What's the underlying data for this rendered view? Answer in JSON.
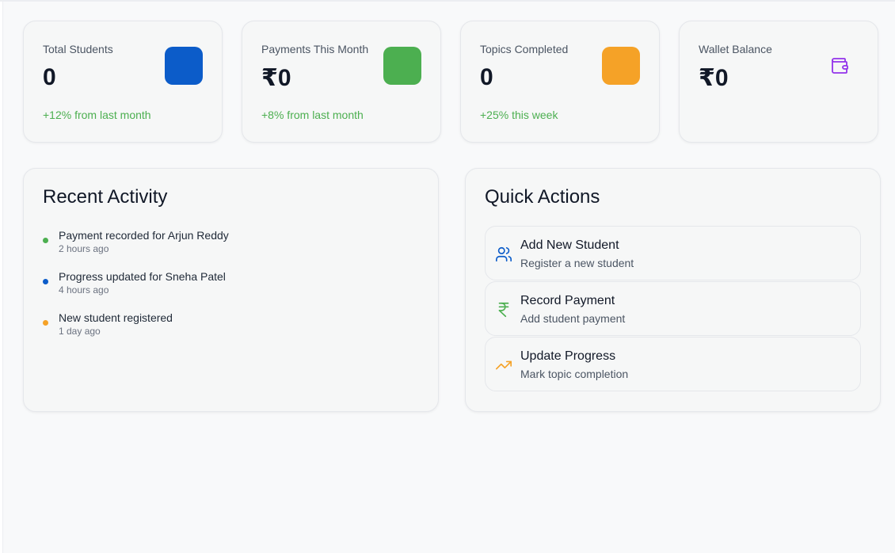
{
  "stats": [
    {
      "label": "Total Students",
      "value": "0",
      "change": "+12% from last month",
      "icon": "blue-square-icon",
      "color": "#0c5cc9"
    },
    {
      "label": "Payments This Month",
      "value": "₹0",
      "change": "+8% from last month",
      "icon": "green-square-icon",
      "color": "#4caf50"
    },
    {
      "label": "Topics Completed",
      "value": "0",
      "change": "+25% this week",
      "icon": "orange-square-icon",
      "color": "#f5a227"
    },
    {
      "label": "Wallet Balance",
      "value": "₹0",
      "change": "",
      "icon": "wallet-icon",
      "color": "#9333ea"
    }
  ],
  "recent_activity": {
    "title": "Recent Activity",
    "items": [
      {
        "text": "Payment recorded for Arjun Reddy",
        "time": "2 hours ago",
        "color": "#4caf50"
      },
      {
        "text": "Progress updated for Sneha Patel",
        "time": "4 hours ago",
        "color": "#0c5cc9"
      },
      {
        "text": "New student registered",
        "time": "1 day ago",
        "color": "#f5a227"
      }
    ]
  },
  "quick_actions": {
    "title": "Quick Actions",
    "items": [
      {
        "title": "Add New Student",
        "subtitle": "Register a new student",
        "icon": "users-icon",
        "color": "#0c5cc9"
      },
      {
        "title": "Record Payment",
        "subtitle": "Add student payment",
        "icon": "rupee-icon",
        "color": "#4caf50"
      },
      {
        "title": "Update Progress",
        "subtitle": "Mark topic completion",
        "icon": "trending-up-icon",
        "color": "#f5a227"
      }
    ]
  }
}
